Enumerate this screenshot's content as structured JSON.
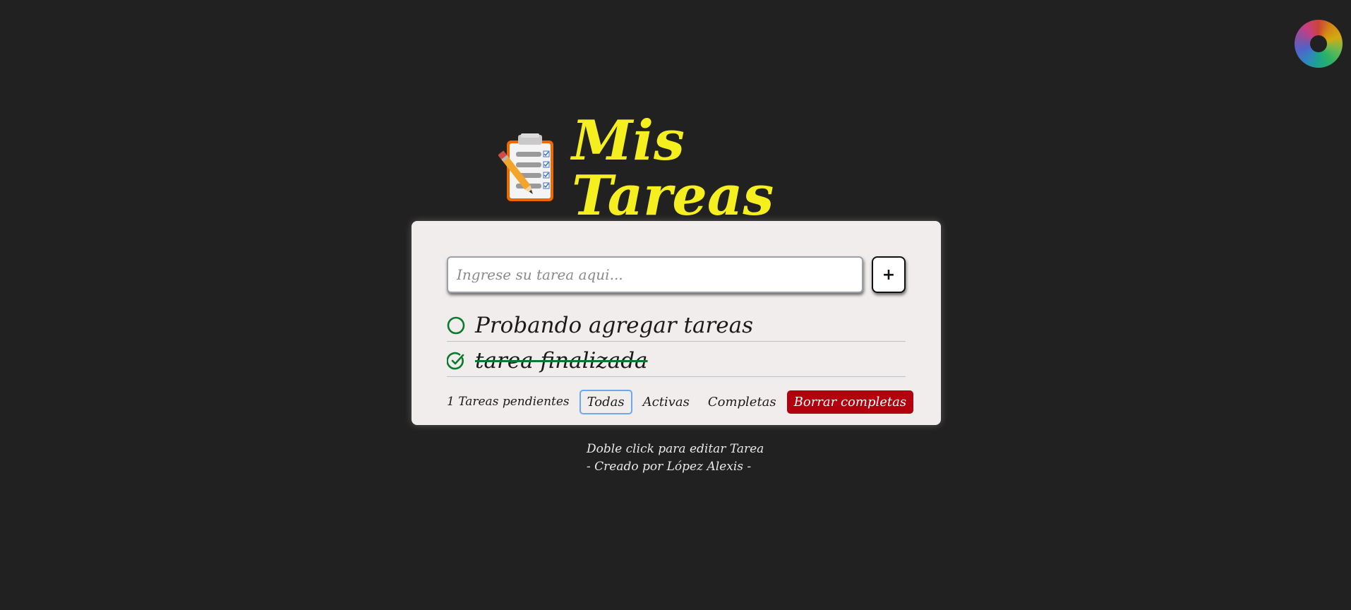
{
  "header": {
    "title": "Mis Tareas",
    "icon": "clipboard-icon"
  },
  "theme_switcher": {
    "icon": "color-wheel-icon"
  },
  "input": {
    "placeholder": "Ingrese su tarea aqui...",
    "value": ""
  },
  "add_button": {
    "label": "+"
  },
  "tasks": [
    {
      "text": "Probando agregar tareas",
      "completed": false
    },
    {
      "text": "tarea finalizada",
      "completed": true
    }
  ],
  "footer": {
    "pending_text": "1 Tareas pendientes",
    "filters": [
      {
        "label": "Todas",
        "selected": true
      },
      {
        "label": "Activas",
        "selected": false
      },
      {
        "label": "Completas",
        "selected": false
      }
    ],
    "clear_label": "Borrar completas"
  },
  "info": {
    "line1": "Doble click para editar Tarea",
    "line2": "- Creado por López Alexis -"
  },
  "colors": {
    "background": "#212121",
    "title": "#f5ef1f",
    "card": "#f0edec",
    "check": "#0b7a2e",
    "clear_button": "#b3000f",
    "selected_filter_border": "#6aa8ef"
  }
}
